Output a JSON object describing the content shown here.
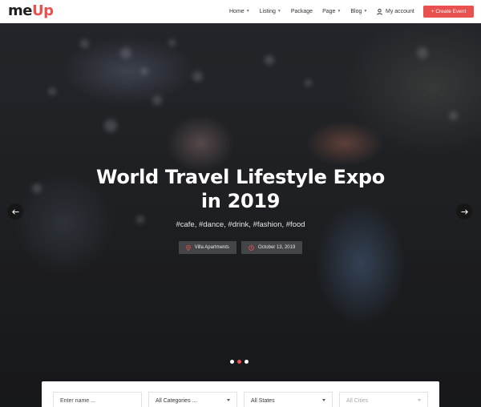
{
  "header": {
    "logo_main": "me",
    "logo_accent": "Up",
    "nav": [
      {
        "label": "Home",
        "has_dropdown": true
      },
      {
        "label": "Listing",
        "has_dropdown": true
      },
      {
        "label": "Package",
        "has_dropdown": false
      },
      {
        "label": "Page",
        "has_dropdown": true
      },
      {
        "label": "Blog",
        "has_dropdown": true
      }
    ],
    "account_label": "My account",
    "account_icon": "user-icon",
    "create_label": "+ Create Event"
  },
  "hero": {
    "title_line1": "World Travel Lifestyle Expo",
    "title_line2": "in 2019",
    "tags": "#cafe, #dance, #drink, #fashion, #food",
    "location_label": "Villa Apartments",
    "location_icon": "map-pin-icon",
    "date_label": "October 13, 2019",
    "date_icon": "clock-icon",
    "slides_total": 3,
    "active_slide": 2
  },
  "search": {
    "name_placeholder": "Enter name ...",
    "category_value": "All Categories ...",
    "state_value": "All States",
    "city_value": "All Cities"
  },
  "colors": {
    "accent": "#e9514f",
    "text_dark": "#333333"
  }
}
